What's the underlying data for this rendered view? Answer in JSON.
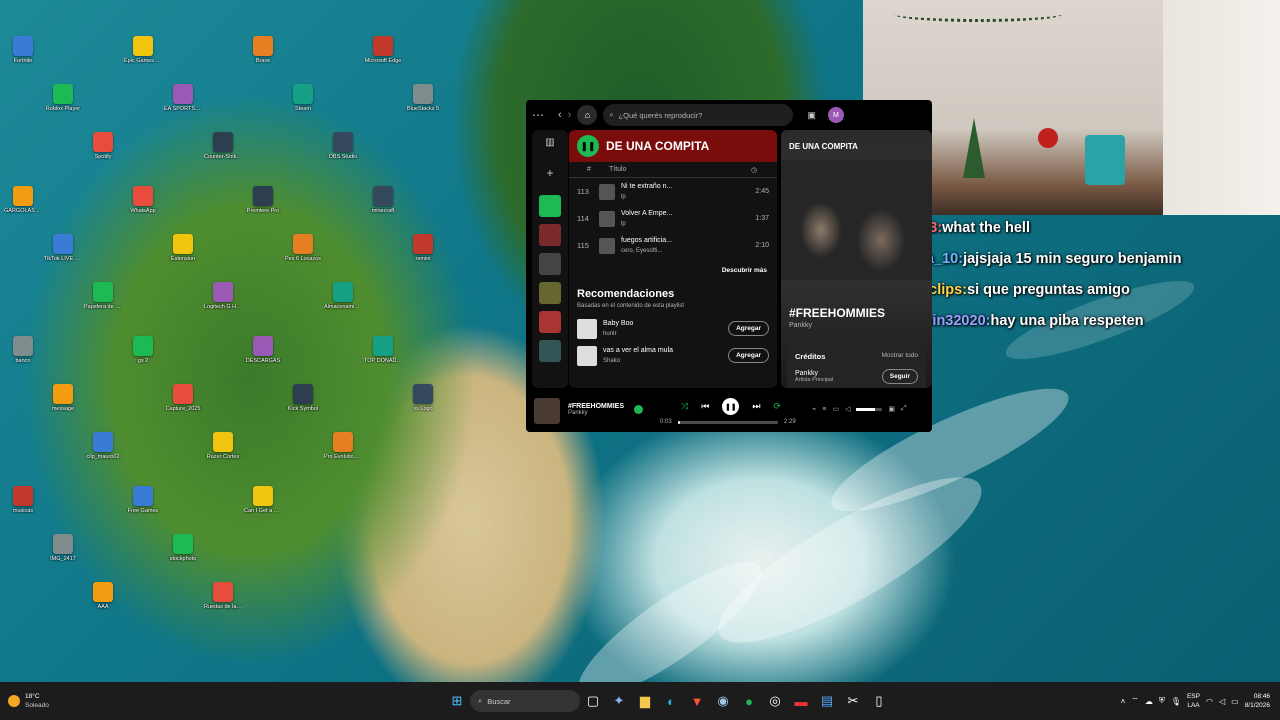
{
  "desktop": {
    "icons": [
      {
        "label": "Fortnite"
      },
      {
        "label": "Roblox Player"
      },
      {
        "label": "Spotify"
      },
      {
        "label": "Epic Games Launcher"
      },
      {
        "label": "EA SPORTS FC 26"
      },
      {
        "label": "Counter-Strike 2"
      },
      {
        "label": "Brave"
      },
      {
        "label": "Steam"
      },
      {
        "label": "OBS Studio"
      },
      {
        "label": "Microsoft Edge"
      },
      {
        "label": "BlueStacks 5"
      },
      {
        "label": "GARGOLAS AWARDS"
      },
      {
        "label": "TikTok LIVE Studio"
      },
      {
        "label": "Papelera de reciclaje"
      },
      {
        "label": "WhatsApp"
      },
      {
        "label": "Extension"
      },
      {
        "label": "Logitech G HUB"
      },
      {
        "label": "Premiere Pro"
      },
      {
        "label": "Pes 6 Locazos"
      },
      {
        "label": "Almacenamiento"
      },
      {
        "label": "minecraft"
      },
      {
        "label": "remini"
      },
      {
        "label": "banco"
      },
      {
        "label": "message"
      },
      {
        "label": "clip_mauro02"
      },
      {
        "label": "gs 2"
      },
      {
        "label": "Capture_2025"
      },
      {
        "label": "Razer Cortex"
      },
      {
        "label": "DESCARGAS"
      },
      {
        "label": "Kick Symbol"
      },
      {
        "label": "Pro Evolution Soccer 6"
      },
      {
        "label": "TOP DONADOR"
      },
      {
        "label": "vs Logo"
      },
      {
        "label": "musicas"
      },
      {
        "label": "IMG_2417"
      },
      {
        "label": "AAA"
      },
      {
        "label": "Free Games"
      },
      {
        "label": "stockphoto"
      },
      {
        "label": "Ruedas de la fortuna"
      },
      {
        "label": "Can I Get a Kiss Mauroo"
      }
    ]
  },
  "spotify": {
    "search_placeholder": "¿Qué querés reproducir?",
    "avatar_letter": "M",
    "playlist_title": "DE UNA COMPITA",
    "col_hash": "#",
    "col_title": "Título",
    "tracks": [
      {
        "n": "113",
        "title": "Ni te extraño n...",
        "artist": "lp",
        "dur": "2:45"
      },
      {
        "n": "114",
        "title": "Volver A Empe...",
        "artist": "lp",
        "dur": "1:37"
      },
      {
        "n": "115",
        "title": "fuegos artificia...",
        "artist": "cero, Eyesofti...",
        "dur": "2:10"
      }
    ],
    "discover": "Descubrir más",
    "rec_title": "Recomendaciones",
    "rec_sub": "Basadas en el contenido de esta playlist",
    "recs": [
      {
        "title": "Baby Boo",
        "artist": "huntr",
        "btn": "Agregar"
      },
      {
        "title": "vas a ver el alma mula",
        "artist": "Shako",
        "btn": "Agregar"
      }
    ],
    "np_header": "DE UNA COMPITA",
    "np_song": "#FREEHOMMIES",
    "np_artist": "Pankky",
    "credits": "Créditos",
    "show_all": "Mostrar todo",
    "credit_artist": "Pankky",
    "credit_role": "Artista Principal",
    "follow": "Seguir",
    "player": {
      "song": "#FREEHOMMIES",
      "artist": "Pankky",
      "elapsed": "0:03",
      "total": "2:29",
      "progress": 0.02,
      "volume": 0.7
    }
  },
  "chat": [
    {
      "user": "Gs_tatii03:",
      "text": "what the hell",
      "color": "#ff6a6a"
    },
    {
      "user": "francha_10:",
      "text": "jajsjaja 15 min seguro benjamin",
      "color": "#6fb4ff"
    },
    {
      "user": "pablitoclips:",
      "text": "si que preguntas amigo",
      "color": "#ffd24a"
    },
    {
      "user": "benjamin32020:",
      "text": "hay una piba respeten",
      "color": "#9aa0ff"
    }
  ],
  "taskbar": {
    "weather_temp": "18°C",
    "weather_desc": "Soleado",
    "search": "Buscar",
    "lang_top": "ESP",
    "lang_bottom": "LAA",
    "time": "08:46",
    "date": "8/1/2026"
  },
  "colors": {
    "spotify_green": "#1db954",
    "playlist_red": "#7a0c0c",
    "taskbar": "#1c1c1c"
  }
}
